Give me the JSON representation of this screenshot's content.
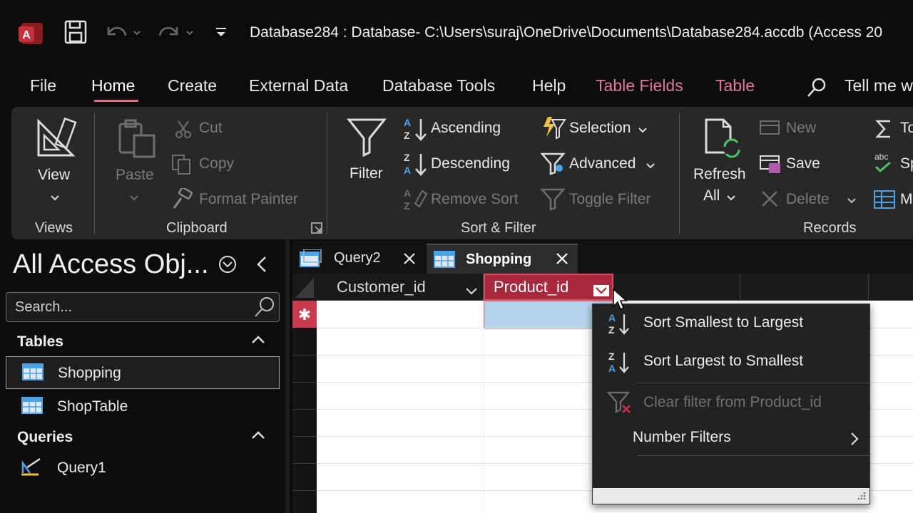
{
  "window": {
    "title": "Database284 : Database- C:\\Users\\suraj\\OneDrive\\Documents\\Database284.accdb (Access 20"
  },
  "menu": {
    "file": "File",
    "home": "Home",
    "create": "Create",
    "external_data": "External Data",
    "database_tools": "Database Tools",
    "help": "Help",
    "table_fields": "Table Fields",
    "table": "Table",
    "tell_me": "Tell me w"
  },
  "ribbon": {
    "views": {
      "view": "View",
      "group": "Views"
    },
    "clipboard": {
      "paste": "Paste",
      "cut": "Cut",
      "copy": "Copy",
      "format_painter": "Format Painter",
      "group": "Clipboard"
    },
    "sort_filter": {
      "filter": "Filter",
      "ascending": "Ascending",
      "descending": "Descending",
      "remove_sort": "Remove Sort",
      "selection": "Selection",
      "advanced": "Advanced",
      "toggle_filter": "Toggle Filter",
      "group": "Sort & Filter"
    },
    "records": {
      "refresh": "Refresh",
      "refresh_all": "All",
      "new": "New",
      "save": "Save",
      "delete": "Delete",
      "group": "Records",
      "totals": "To",
      "spelling": "Sp",
      "more": "M"
    }
  },
  "nav": {
    "title": "All Access Obj...",
    "search_placeholder": "Search...",
    "tables_header": "Tables",
    "tables": [
      "Shopping",
      "ShopTable"
    ],
    "queries_header": "Queries",
    "queries": [
      "Query1"
    ]
  },
  "tabs": [
    {
      "label": "Query2",
      "active": false
    },
    {
      "label": "Shopping",
      "active": true
    }
  ],
  "datasheet": {
    "columns": [
      "Customer_id",
      "Product_id"
    ],
    "new_row_marker": "✱"
  },
  "dropdown": {
    "sort_asc": "Sort Smallest to Largest",
    "sort_desc": "Sort Largest to Smallest",
    "clear_filter": "Clear filter from Product_id",
    "number_filters": "Number Filters"
  },
  "colors": {
    "accent_pink": "#e06c8a",
    "selected_cell": "#b4d4ec",
    "new_record_marker": "#c83a4d",
    "filter_icon_red": "#d03040"
  }
}
